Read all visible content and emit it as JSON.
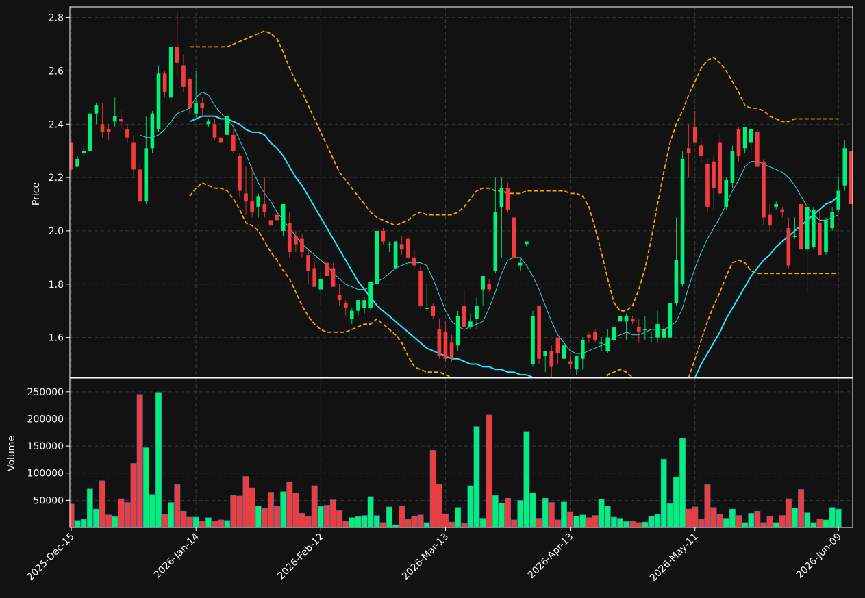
{
  "chart_data": {
    "type": "candlestick",
    "panels": {
      "price": {
        "ylabel": "Price",
        "ylim": [
          1.45,
          2.84
        ],
        "yticks": [
          "1.6",
          "1.8",
          "2.0",
          "2.2",
          "2.4",
          "2.6",
          "2.8"
        ]
      },
      "volume": {
        "ylabel": "Volume",
        "ylim": [
          0,
          275000
        ],
        "yticks": [
          "50000",
          "100000",
          "150000",
          "200000",
          "250000"
        ]
      }
    },
    "x_start": "2025-12-15",
    "x_ticks": [
      "2025-Dec-15",
      "2026-Jan-14",
      "2026-Feb-12",
      "2026-Mar-13",
      "2026-Apr-13",
      "2026-May-11",
      "2026-Jun-09"
    ],
    "x_tick_index": [
      0,
      20,
      40,
      60,
      80,
      100,
      123
    ],
    "grid": true,
    "colors": {
      "background": "#121212",
      "up": "#00f07a",
      "down": "#f03c3c",
      "sma_fast": "#3ad6d6",
      "sma_slow": "#22e6ff",
      "bands": "#ffa500",
      "grid": "#3a3a3a"
    },
    "ohlc": [
      [
        2.33,
        2.34,
        2.22,
        2.23
      ],
      [
        2.24,
        2.28,
        2.24,
        2.27
      ],
      [
        2.29,
        2.32,
        2.28,
        2.3
      ],
      [
        2.3,
        2.46,
        2.29,
        2.44
      ],
      [
        2.44,
        2.48,
        2.4,
        2.47
      ],
      [
        2.4,
        2.48,
        2.35,
        2.37
      ],
      [
        2.38,
        2.4,
        2.34,
        2.37
      ],
      [
        2.41,
        2.5,
        2.39,
        2.43
      ],
      [
        2.42,
        2.45,
        2.38,
        2.41
      ],
      [
        2.38,
        2.4,
        2.33,
        2.35
      ],
      [
        2.33,
        2.36,
        2.2,
        2.23
      ],
      [
        2.23,
        2.25,
        2.1,
        2.11
      ],
      [
        2.11,
        2.43,
        2.1,
        2.31
      ],
      [
        2.31,
        2.45,
        2.29,
        2.44
      ],
      [
        2.38,
        2.62,
        2.37,
        2.59
      ],
      [
        2.59,
        2.6,
        2.5,
        2.52
      ],
      [
        2.5,
        2.7,
        2.48,
        2.69
      ],
      [
        2.69,
        2.82,
        2.58,
        2.63
      ],
      [
        2.62,
        2.66,
        2.52,
        2.54
      ],
      [
        2.57,
        2.58,
        2.44,
        2.46
      ],
      [
        2.44,
        2.6,
        2.42,
        2.48
      ],
      [
        2.48,
        2.5,
        2.43,
        2.46
      ],
      [
        2.4,
        2.42,
        2.39,
        2.41
      ],
      [
        2.4,
        2.42,
        2.34,
        2.35
      ],
      [
        2.35,
        2.38,
        2.31,
        2.33
      ],
      [
        2.36,
        2.43,
        2.33,
        2.43
      ],
      [
        2.36,
        2.38,
        2.29,
        2.3
      ],
      [
        2.28,
        2.29,
        2.13,
        2.15
      ],
      [
        2.14,
        2.24,
        2.06,
        2.11
      ],
      [
        2.11,
        2.24,
        2.05,
        2.07
      ],
      [
        2.09,
        2.14,
        2.05,
        2.13
      ],
      [
        2.1,
        2.2,
        2.05,
        2.07
      ],
      [
        2.04,
        2.1,
        2.01,
        2.02
      ],
      [
        2.06,
        2.11,
        2.01,
        2.04
      ],
      [
        2.0,
        2.1,
        1.98,
        2.1
      ],
      [
        2.03,
        2.07,
        1.9,
        1.92
      ],
      [
        1.98,
        2.0,
        1.92,
        1.95
      ],
      [
        1.97,
        1.99,
        1.9,
        1.92
      ],
      [
        1.91,
        1.93,
        1.8,
        1.85
      ],
      [
        1.86,
        1.88,
        1.79,
        1.79
      ],
      [
        1.78,
        1.85,
        1.72,
        1.82
      ],
      [
        1.88,
        1.93,
        1.83,
        1.83
      ],
      [
        1.86,
        1.88,
        1.79,
        1.79
      ],
      [
        1.76,
        1.8,
        1.72,
        1.74
      ],
      [
        1.73,
        1.74,
        1.68,
        1.71
      ],
      [
        1.67,
        1.71,
        1.65,
        1.7
      ],
      [
        1.7,
        1.74,
        1.68,
        1.74
      ],
      [
        1.71,
        1.75,
        1.69,
        1.74
      ],
      [
        1.71,
        1.81,
        1.7,
        1.81
      ],
      [
        1.8,
        2.0,
        1.79,
        2.0
      ],
      [
        2.0,
        2.01,
        1.95,
        1.96
      ],
      [
        1.95,
        1.96,
        1.92,
        1.95
      ],
      [
        1.86,
        1.96,
        1.86,
        1.96
      ],
      [
        1.95,
        1.98,
        1.91,
        1.93
      ],
      [
        1.97,
        1.98,
        1.89,
        1.9
      ],
      [
        1.9,
        1.93,
        1.86,
        1.87
      ],
      [
        1.85,
        1.87,
        1.71,
        1.72
      ],
      [
        1.71,
        1.8,
        1.7,
        1.71
      ],
      [
        1.72,
        1.73,
        1.67,
        1.68
      ],
      [
        1.63,
        1.67,
        1.52,
        1.53
      ],
      [
        1.62,
        1.66,
        1.51,
        1.52
      ],
      [
        1.58,
        1.61,
        1.51,
        1.52
      ],
      [
        1.57,
        1.7,
        1.55,
        1.68
      ],
      [
        1.72,
        1.78,
        1.64,
        1.64
      ],
      [
        1.64,
        1.69,
        1.63,
        1.66
      ],
      [
        1.67,
        1.75,
        1.63,
        1.72
      ],
      [
        1.78,
        1.83,
        1.72,
        1.83
      ],
      [
        1.8,
        1.82,
        1.77,
        1.78
      ],
      [
        1.85,
        2.2,
        1.84,
        2.07
      ],
      [
        2.09,
        2.2,
        1.9,
        2.16
      ],
      [
        2.16,
        2.18,
        2.07,
        2.08
      ],
      [
        2.05,
        2.07,
        1.9,
        1.9
      ],
      [
        1.87,
        1.9,
        1.85,
        1.88
      ],
      [
        1.95,
        1.96,
        1.94,
        1.96
      ],
      [
        1.5,
        1.7,
        1.49,
        1.68
      ],
      [
        1.72,
        1.72,
        1.5,
        1.52
      ],
      [
        1.53,
        1.55,
        1.47,
        1.55
      ],
      [
        1.55,
        1.57,
        1.45,
        1.49
      ],
      [
        1.6,
        1.6,
        1.5,
        1.54
      ],
      [
        1.52,
        1.57,
        1.45,
        1.57
      ],
      [
        1.51,
        1.53,
        1.48,
        1.5
      ],
      [
        1.48,
        1.53,
        1.46,
        1.53
      ],
      [
        1.52,
        1.6,
        1.48,
        1.59
      ],
      [
        1.61,
        1.62,
        1.58,
        1.6
      ],
      [
        1.62,
        1.63,
        1.58,
        1.59
      ],
      [
        1.58,
        1.6,
        1.55,
        1.58
      ],
      [
        1.55,
        1.63,
        1.54,
        1.6
      ],
      [
        1.59,
        1.66,
        1.58,
        1.64
      ],
      [
        1.66,
        1.73,
        1.64,
        1.68
      ],
      [
        1.66,
        1.69,
        1.59,
        1.68
      ],
      [
        1.67,
        1.68,
        1.65,
        1.66
      ],
      [
        1.64,
        1.67,
        1.58,
        1.62
      ],
      [
        1.63,
        1.68,
        1.59,
        1.63
      ],
      [
        1.6,
        1.62,
        1.58,
        1.6
      ],
      [
        1.6,
        1.7,
        1.58,
        1.65
      ],
      [
        1.6,
        1.65,
        1.59,
        1.63
      ],
      [
        1.6,
        1.7,
        1.58,
        1.73
      ],
      [
        1.73,
        2.05,
        1.72,
        1.89
      ],
      [
        1.8,
        2.3,
        1.79,
        2.27
      ],
      [
        2.31,
        2.4,
        2.2,
        2.29
      ],
      [
        2.39,
        2.45,
        2.33,
        2.33
      ],
      [
        2.32,
        2.35,
        2.26,
        2.28
      ],
      [
        2.25,
        2.27,
        2.07,
        2.09
      ],
      [
        2.26,
        2.28,
        2.08,
        2.16
      ],
      [
        2.33,
        2.36,
        2.13,
        2.14
      ],
      [
        2.09,
        2.2,
        2.08,
        2.19
      ],
      [
        2.18,
        2.32,
        2.16,
        2.3
      ],
      [
        2.38,
        2.39,
        2.26,
        2.28
      ],
      [
        2.31,
        2.39,
        2.29,
        2.39
      ],
      [
        2.33,
        2.38,
        2.29,
        2.38
      ],
      [
        2.37,
        2.38,
        2.24,
        2.24
      ],
      [
        2.26,
        2.27,
        2.02,
        2.05
      ],
      [
        2.06,
        2.1,
        2.0,
        2.02
      ],
      [
        2.09,
        2.11,
        2.08,
        2.1
      ],
      [
        2.08,
        2.09,
        2.05,
        2.07
      ],
      [
        2.01,
        2.05,
        1.86,
        1.87
      ],
      [
        1.98,
        2.05,
        1.97,
        1.98
      ],
      [
        2.1,
        2.12,
        1.92,
        1.93
      ],
      [
        1.93,
        2.03,
        1.77,
        2.09
      ],
      [
        1.94,
        2.09,
        1.93,
        2.08
      ],
      [
        2.03,
        2.08,
        1.91,
        1.91
      ],
      [
        1.92,
        2.05,
        1.91,
        2.04
      ],
      [
        2.01,
        2.09,
        2.0,
        2.07
      ],
      [
        2.08,
        2.2,
        2.07,
        2.15
      ],
      [
        2.17,
        2.34,
        2.15,
        2.31
      ],
      [
        2.3,
        2.31,
        2.09,
        2.1
      ]
    ],
    "volume": [
      43000,
      13000,
      15000,
      71000,
      34000,
      86000,
      23000,
      20000,
      53000,
      46000,
      118000,
      245000,
      147000,
      61000,
      249000,
      24000,
      46000,
      79000,
      30000,
      19000,
      19000,
      11000,
      18000,
      11000,
      14000,
      13000,
      59000,
      58000,
      94000,
      73000,
      40000,
      35000,
      65000,
      39000,
      66000,
      84000,
      64000,
      26000,
      20000,
      77000,
      39000,
      41000,
      51000,
      31000,
      11000,
      18000,
      20000,
      22000,
      57000,
      22000,
      9000,
      38000,
      5000,
      40000,
      15000,
      21000,
      23000,
      9000,
      142000,
      80000,
      25000,
      10000,
      37000,
      8000,
      77000,
      186000,
      17000,
      207000,
      59000,
      45000,
      54000,
      14000,
      50000,
      177000,
      64000,
      17000,
      54000,
      46000,
      14000,
      47000,
      29000,
      21000,
      23000,
      18000,
      22000,
      52000,
      40000,
      19000,
      17000,
      11000,
      11000,
      9000,
      10000,
      21000,
      24000,
      126000,
      44000,
      93000,
      164000,
      34000,
      38000,
      15000,
      79000,
      37000,
      24000,
      17000,
      34000,
      22000,
      9000,
      26000,
      30000,
      9000,
      20000,
      9000,
      22000,
      53000,
      36000,
      70000,
      27000,
      9000,
      16000,
      14000,
      37000,
      34000
    ],
    "sma_fast": [
      null,
      null,
      null,
      null,
      null,
      null,
      null,
      null,
      null,
      null,
      null,
      2.36,
      2.35,
      2.35,
      2.36,
      2.38,
      2.41,
      2.44,
      2.45,
      2.46,
      2.5,
      2.52,
      2.51,
      2.47,
      2.44,
      2.42,
      2.39,
      2.34,
      2.29,
      2.23,
      2.18,
      2.14,
      2.11,
      2.07,
      2.04,
      2.01,
      1.98,
      1.95,
      1.93,
      1.91,
      1.89,
      1.87,
      1.84,
      1.82,
      1.8,
      1.79,
      1.78,
      1.78,
      1.79,
      1.81,
      1.82,
      1.84,
      1.86,
      1.87,
      1.88,
      1.88,
      1.88,
      1.87,
      1.82,
      1.76,
      1.7,
      1.66,
      1.64,
      1.63,
      1.64,
      1.65,
      1.66,
      1.71,
      1.77,
      1.84,
      1.89,
      1.9,
      1.9,
      1.87,
      1.83,
      1.78,
      1.72,
      1.66,
      1.61,
      1.58,
      1.55,
      1.54,
      1.54,
      1.55,
      1.56,
      1.57,
      1.58,
      1.6,
      1.61,
      1.62,
      1.61,
      1.61,
      1.62,
      1.63,
      1.63,
      1.63,
      1.64,
      1.66,
      1.71,
      1.79,
      1.86,
      1.92,
      1.97,
      2.01,
      2.05,
      2.1,
      2.15,
      2.19,
      2.24,
      2.26,
      2.26,
      2.25,
      2.24,
      2.23,
      2.22,
      2.2,
      2.17,
      2.13,
      2.09,
      2.06,
      2.04,
      2.04,
      2.05,
      2.06
    ],
    "sma_slow": [
      null,
      null,
      null,
      null,
      null,
      null,
      null,
      null,
      null,
      null,
      null,
      null,
      null,
      null,
      null,
      null,
      null,
      null,
      null,
      2.41,
      2.42,
      2.43,
      2.43,
      2.43,
      2.42,
      2.42,
      2.41,
      2.4,
      2.38,
      2.37,
      2.37,
      2.36,
      2.33,
      2.31,
      2.28,
      2.24,
      2.2,
      2.17,
      2.13,
      2.09,
      2.05,
      2.01,
      1.97,
      1.93,
      1.89,
      1.85,
      1.81,
      1.78,
      1.75,
      1.72,
      1.7,
      1.68,
      1.66,
      1.64,
      1.62,
      1.6,
      1.58,
      1.56,
      1.55,
      1.54,
      1.53,
      1.52,
      1.52,
      1.51,
      1.5,
      1.5,
      1.49,
      1.49,
      1.48,
      1.48,
      1.47,
      1.47,
      1.46,
      1.46,
      1.45,
      1.45,
      1.44,
      1.44,
      1.43,
      1.43,
      1.42,
      1.41,
      1.4,
      1.39,
      1.38,
      1.37,
      1.36,
      1.35,
      1.35,
      1.34,
      1.34,
      1.33,
      1.32,
      1.32,
      1.32,
      1.32,
      1.33,
      1.35,
      1.38,
      1.41,
      1.45,
      1.5,
      1.54,
      1.58,
      1.62,
      1.67,
      1.71,
      1.75,
      1.79,
      1.83,
      1.86,
      1.89,
      1.91,
      1.94,
      1.96,
      1.98,
      2.0,
      2.02,
      2.04,
      2.06,
      2.08,
      2.1,
      2.11,
      2.13
    ],
    "band_upper": [
      null,
      null,
      null,
      null,
      null,
      null,
      null,
      null,
      null,
      null,
      null,
      null,
      null,
      null,
      null,
      null,
      null,
      null,
      null,
      2.69,
      2.69,
      2.69,
      2.69,
      2.69,
      2.69,
      2.69,
      2.7,
      2.71,
      2.72,
      2.73,
      2.74,
      2.75,
      2.74,
      2.72,
      2.67,
      2.61,
      2.56,
      2.52,
      2.47,
      2.42,
      2.37,
      2.32,
      2.27,
      2.22,
      2.19,
      2.16,
      2.13,
      2.1,
      2.07,
      2.05,
      2.04,
      2.03,
      2.02,
      2.03,
      2.04,
      2.06,
      2.07,
      2.06,
      2.06,
      2.06,
      2.06,
      2.06,
      2.07,
      2.09,
      2.12,
      2.15,
      2.16,
      2.16,
      2.15,
      2.15,
      2.14,
      2.14,
      2.14,
      2.15,
      2.15,
      2.15,
      2.15,
      2.15,
      2.15,
      2.15,
      2.14,
      2.14,
      2.13,
      2.09,
      2.01,
      1.92,
      1.82,
      1.73,
      1.7,
      1.7,
      1.72,
      1.78,
      1.86,
      1.97,
      2.1,
      2.22,
      2.33,
      2.4,
      2.45,
      2.51,
      2.56,
      2.61,
      2.64,
      2.65,
      2.63,
      2.6,
      2.56,
      2.52,
      2.47,
      2.46,
      2.46,
      2.45,
      2.43,
      2.42,
      2.41,
      2.41,
      2.42,
      2.42,
      2.42,
      2.42,
      2.42,
      2.42,
      2.42,
      2.42
    ],
    "band_lower": [
      null,
      null,
      null,
      null,
      null,
      null,
      null,
      null,
      null,
      null,
      null,
      null,
      null,
      null,
      null,
      null,
      null,
      null,
      null,
      2.13,
      2.16,
      2.18,
      2.17,
      2.16,
      2.16,
      2.15,
      2.12,
      2.08,
      2.03,
      2.02,
      2.0,
      1.96,
      1.92,
      1.89,
      1.85,
      1.82,
      1.77,
      1.72,
      1.68,
      1.65,
      1.63,
      1.62,
      1.62,
      1.62,
      1.62,
      1.63,
      1.64,
      1.65,
      1.65,
      1.67,
      1.65,
      1.63,
      1.61,
      1.58,
      1.53,
      1.49,
      1.48,
      1.47,
      1.47,
      1.47,
      1.46,
      1.45,
      1.45,
      1.44,
      1.44,
      1.44,
      1.44,
      1.43,
      1.42,
      1.41,
      1.39,
      1.37,
      1.35,
      1.33,
      1.31,
      1.29,
      1.27,
      1.25,
      1.23,
      1.21,
      1.19,
      1.17,
      1.16,
      1.2,
      1.31,
      1.4,
      1.46,
      1.47,
      1.48,
      1.47,
      1.45,
      1.4,
      1.35,
      1.3,
      1.27,
      1.26,
      1.28,
      1.32,
      1.38,
      1.45,
      1.52,
      1.59,
      1.66,
      1.72,
      1.77,
      1.83,
      1.88,
      1.89,
      1.88,
      1.85,
      1.84,
      1.84,
      1.84,
      1.84,
      1.84,
      1.84,
      1.84,
      1.84,
      1.84,
      1.84,
      1.84,
      1.84,
      1.84,
      1.84
    ]
  }
}
